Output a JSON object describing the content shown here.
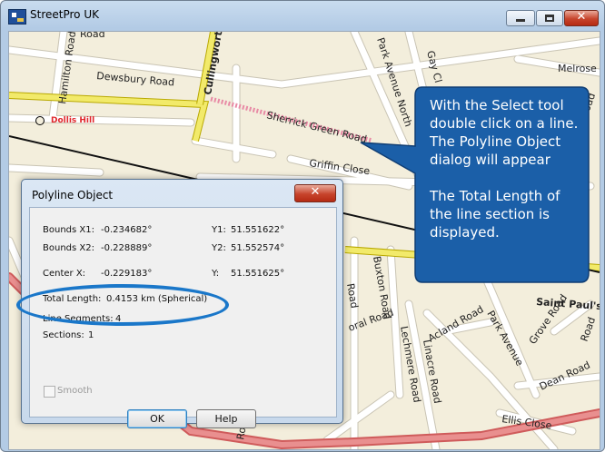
{
  "window": {
    "title": "StreetPro UK",
    "buttons": {
      "minimize": "minimize-icon",
      "maximize": "maximize-icon",
      "close": "close-icon"
    },
    "close_glyph": "✕"
  },
  "map": {
    "place": {
      "name": "Dollis Hill",
      "color": "#e0262b"
    },
    "roads": {
      "r1": "Road",
      "r2": "Hamilton Road",
      "r3": "Dewsbury Road",
      "r4": "Cullingworth",
      "r5": "Sherrick Green Road",
      "r6": "Park Avenue North",
      "r7": "Gay Cl",
      "r8": "Melrose",
      "r9": "Griffin Close",
      "r10": "Riffe",
      "r11": "Saint Paul's",
      "r12": "Buxton Road",
      "r13": "Lechmere Road",
      "r14": "Linacre Road",
      "r15": "Acland Road",
      "r16": "Park Avenue",
      "r17": "Grove Road",
      "r18": "Dean Road",
      "r19": "Ellis Close",
      "r20": "Road",
      "r21": "oral Road",
      "r22": "Road",
      "r23": "Road",
      "r24": "Road"
    }
  },
  "callout": {
    "para1": "With the Select tool double click on a line.  The Polyline Object dialog will appear",
    "para2": "The Total Length of the line section is displayed.",
    "color": "#1b5fa8"
  },
  "dialog": {
    "title": "Polyline Object",
    "close_glyph": "✕",
    "bounds_x1_label": "Bounds X1:",
    "bounds_x1_value": "-0.234682°",
    "y1_label": "Y1:",
    "y1_value": "51.551622°",
    "bounds_x2_label": "Bounds X2:",
    "bounds_x2_value": "-0.228889°",
    "y2_label": "Y2:",
    "y2_value": "51.552574°",
    "center_x_label": "Center X:",
    "center_x_value": "-0.229183°",
    "y_label": "Y:",
    "y_value": "51.551625°",
    "total_length_label": "Total Length:",
    "total_length_value": "0.4153 km (Spherical)",
    "line_segments_label": "Line Segments:",
    "line_segments_value": "4",
    "sections_label": "Sections:",
    "sections_value": "1",
    "smooth_label": "Smooth",
    "ok_label": "OK",
    "help_label": "Help"
  },
  "highlight_color": "#1a77c9"
}
